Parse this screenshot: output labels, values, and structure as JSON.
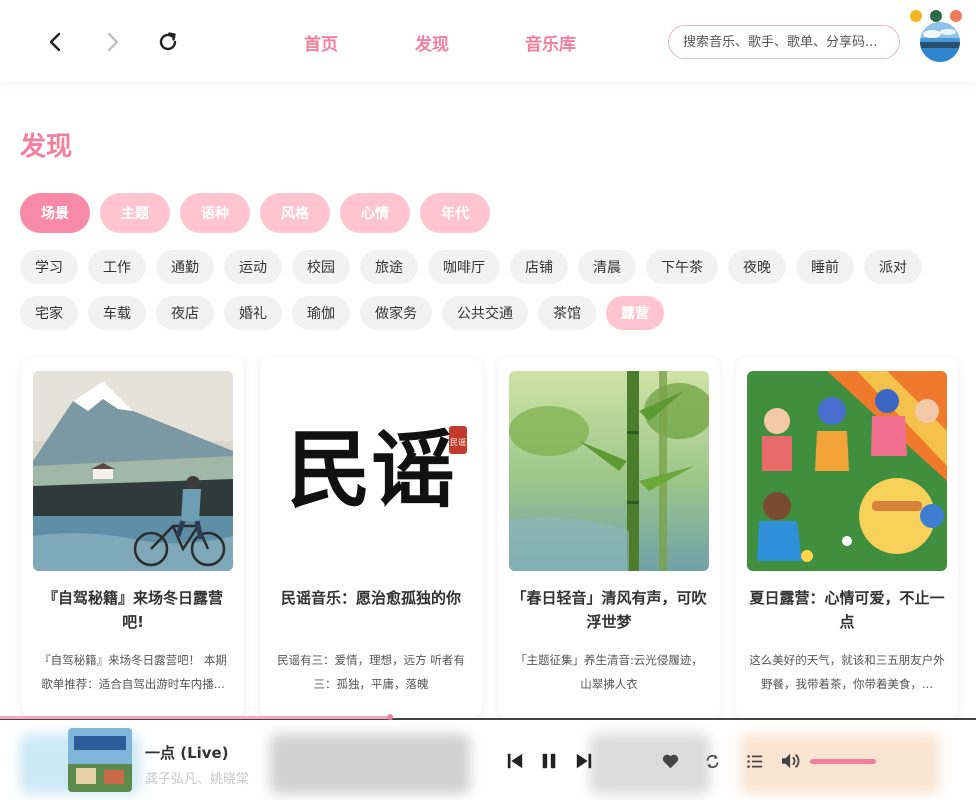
{
  "nav": {
    "back": "back-arrow",
    "forward": "forward-arrow",
    "refresh": "refresh"
  },
  "top_tabs": [
    "首页",
    "发现",
    "音乐库"
  ],
  "search": {
    "placeholder": "搜索音乐、歌手、歌单、分享码..."
  },
  "page_title": "发现",
  "categories": [
    {
      "label": "场景",
      "active": true
    },
    {
      "label": "主题",
      "active": false
    },
    {
      "label": "语种",
      "active": false
    },
    {
      "label": "风格",
      "active": false
    },
    {
      "label": "心情",
      "active": false
    },
    {
      "label": "年代",
      "active": false
    }
  ],
  "tags_row1": [
    "学习",
    "工作",
    "通勤",
    "运动",
    "校园",
    "旅途",
    "咖啡厅",
    "店铺",
    "清晨",
    "下午茶",
    "夜晚",
    "睡前",
    "派对"
  ],
  "tags_row2": [
    "宅家",
    "车载",
    "夜店",
    "婚礼",
    "瑜伽",
    "做家务",
    "公共交通",
    "茶馆",
    "露营"
  ],
  "active_tag": "露营",
  "playlists": [
    {
      "title": "『自驾秘籍』来场冬日露营吧!",
      "desc": "『自驾秘籍』来场冬日露营吧！ 本期歌单推荐：适合自驾出游时车内播...",
      "cover": "mountain-cyclist"
    },
    {
      "title": "民谣音乐：愿治愈孤独的你",
      "desc": "民谣有三：爱情，理想，远方 听者有三：孤独，平庸，落魄",
      "cover": "calligraphy",
      "cover_text": "民谣",
      "seal_text": "民谣"
    },
    {
      "title": "「春日轻音」清风有声，可吹浮世梦",
      "desc": "「主题征集」养生清音:云光侵履迹，山翠拂人衣",
      "cover": "bamboo"
    },
    {
      "title": "夏日露营：心情可爱，不止一点",
      "desc": "这么美好的天气，就该和三五朋友户外野餐，我带着茶，你带着美食，...",
      "cover": "picnic-illustration"
    }
  ],
  "player": {
    "song": "一点 (Live)",
    "artist": "龚子弘凡、姚晓棠",
    "progress": 0.4,
    "volume": 0.7
  },
  "window_dots": [
    "#f5b523",
    "#2e6b4a",
    "#f07a5a"
  ],
  "colors": {
    "accent": "#f27ea0",
    "chip_light": "#ffc4cf",
    "chip_active": "#f989a8"
  }
}
